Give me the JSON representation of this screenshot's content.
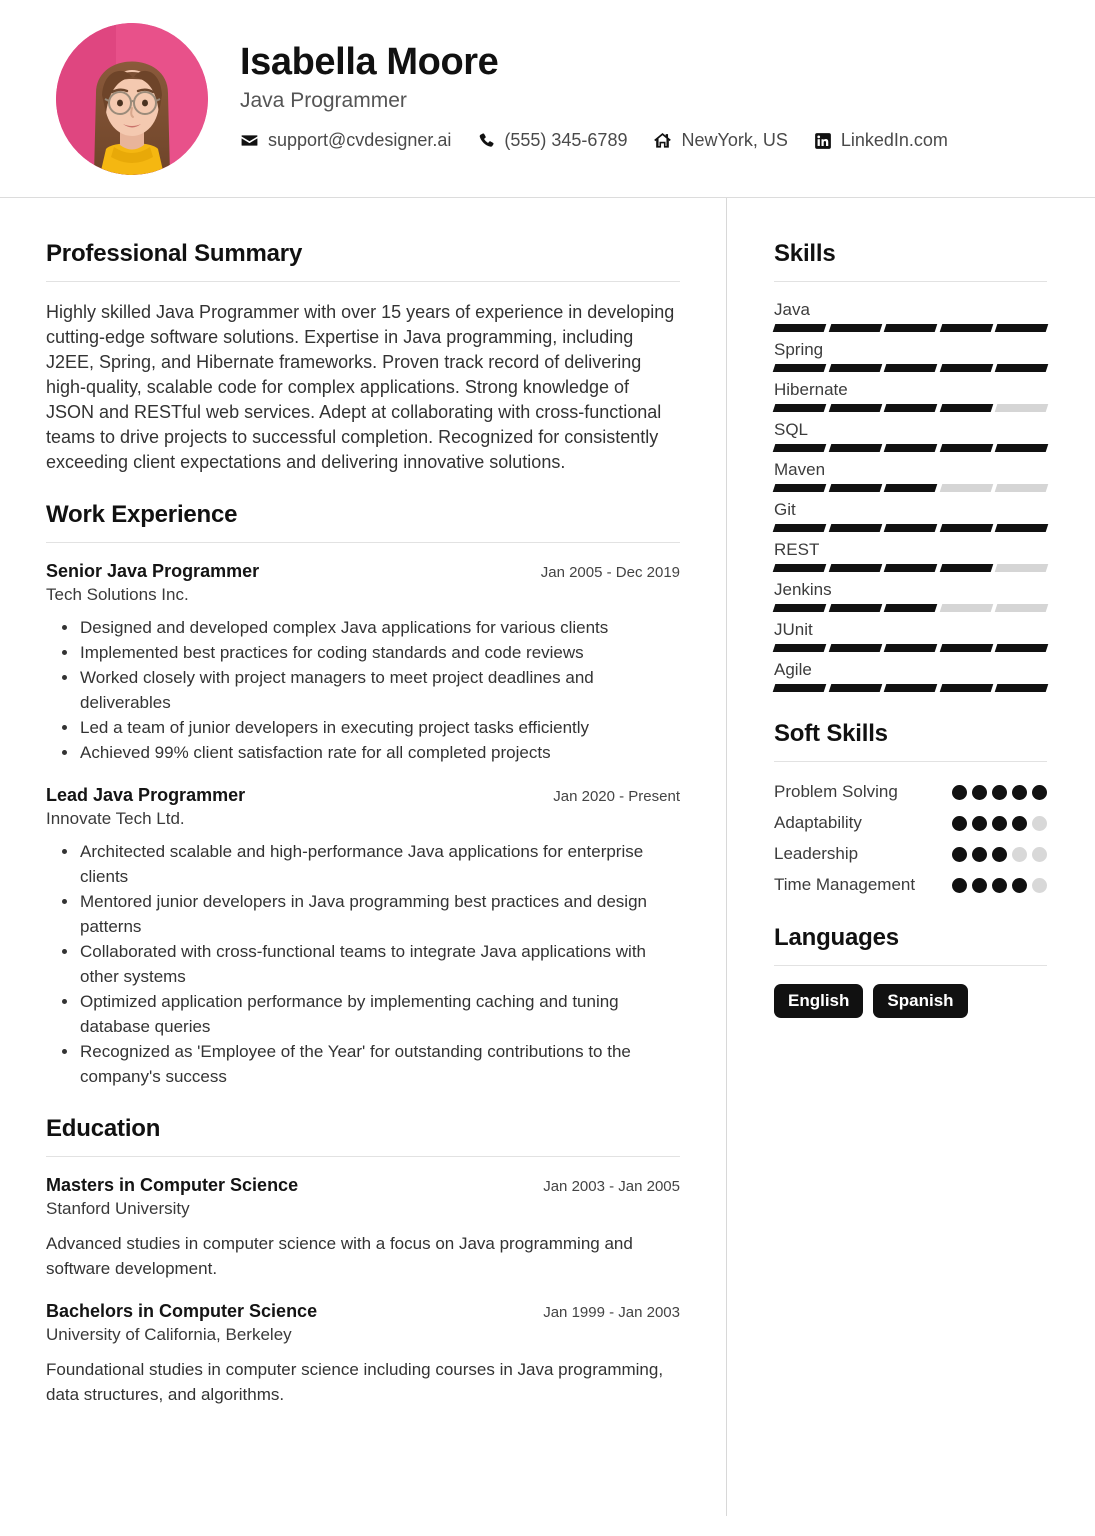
{
  "header": {
    "name": "Isabella Moore",
    "job_title": "Java Programmer",
    "avatar_alt": "profile-photo",
    "contacts": [
      {
        "icon": "envelope-icon",
        "label": "support@cvdesigner.ai"
      },
      {
        "icon": "phone-icon",
        "label": "(555) 345-6789"
      },
      {
        "icon": "home-icon",
        "label": "NewYork, US"
      },
      {
        "icon": "linkedin-icon",
        "label": "LinkedIn.com"
      }
    ]
  },
  "main": {
    "summary": {
      "title": "Professional Summary",
      "text": "Highly skilled Java Programmer with over 15 years of experience in developing cutting-edge software solutions. Expertise in Java programming, including J2EE, Spring, and Hibernate frameworks. Proven track record of delivering high-quality, scalable code for complex applications. Strong knowledge of JSON and RESTful web services. Adept at collaborating with cross-functional teams to drive projects to successful completion. Recognized for consistently exceeding client expectations and delivering innovative solutions."
    },
    "work": {
      "title": "Work Experience",
      "entries": [
        {
          "role": "Senior Java Programmer",
          "date": "Jan 2005 - Dec 2019",
          "org": "Tech Solutions Inc.",
          "bullets": [
            "Designed and developed complex Java applications for various clients",
            "Implemented best practices for coding standards and code reviews",
            "Worked closely with project managers to meet project deadlines and deliverables",
            "Led a team of junior developers in executing project tasks efficiently",
            "Achieved 99% client satisfaction rate for all completed projects"
          ]
        },
        {
          "role": "Lead Java Programmer",
          "date": "Jan 2020 - Present",
          "org": "Innovate Tech Ltd.",
          "bullets": [
            "Architected scalable and high-performance Java applications for enterprise clients",
            "Mentored junior developers in Java programming best practices and design patterns",
            "Collaborated with cross-functional teams to integrate Java applications with other systems",
            "Optimized application performance by implementing caching and tuning database queries",
            "Recognized as 'Employee of the Year' for outstanding contributions to the company's success"
          ]
        }
      ]
    },
    "education": {
      "title": "Education",
      "entries": [
        {
          "degree": "Masters in Computer Science",
          "date": "Jan 2003 - Jan 2005",
          "school": "Stanford University",
          "description": "Advanced studies in computer science with a focus on Java programming and software development."
        },
        {
          "degree": "Bachelors in Computer Science",
          "date": "Jan 1999 - Jan 2003",
          "school": "University of California, Berkeley",
          "description": "Foundational studies in computer science including courses in Java programming, data structures, and algorithms."
        }
      ]
    }
  },
  "sidebar": {
    "skills": {
      "title": "Skills",
      "max": 5,
      "items": [
        {
          "name": "Java",
          "level": 5
        },
        {
          "name": "Spring",
          "level": 5
        },
        {
          "name": "Hibernate",
          "level": 4
        },
        {
          "name": "SQL",
          "level": 5
        },
        {
          "name": "Maven",
          "level": 3
        },
        {
          "name": "Git",
          "level": 5
        },
        {
          "name": "REST",
          "level": 4
        },
        {
          "name": "Jenkins",
          "level": 3
        },
        {
          "name": "JUnit",
          "level": 5
        },
        {
          "name": "Agile",
          "level": 5
        }
      ]
    },
    "soft_skills": {
      "title": "Soft Skills",
      "max": 5,
      "items": [
        {
          "name": "Problem Solving",
          "level": 5
        },
        {
          "name": "Adaptability",
          "level": 4
        },
        {
          "name": "Leadership",
          "level": 3
        },
        {
          "name": "Time Management",
          "level": 4
        }
      ]
    },
    "languages": {
      "title": "Languages",
      "items": [
        "English",
        "Spanish"
      ]
    }
  },
  "colors": {
    "accent": "#111111",
    "muted_bar": "#d5d5d5",
    "rule": "#e2e2e2",
    "avatar_bg": "#e8518a",
    "text": "#333333"
  }
}
